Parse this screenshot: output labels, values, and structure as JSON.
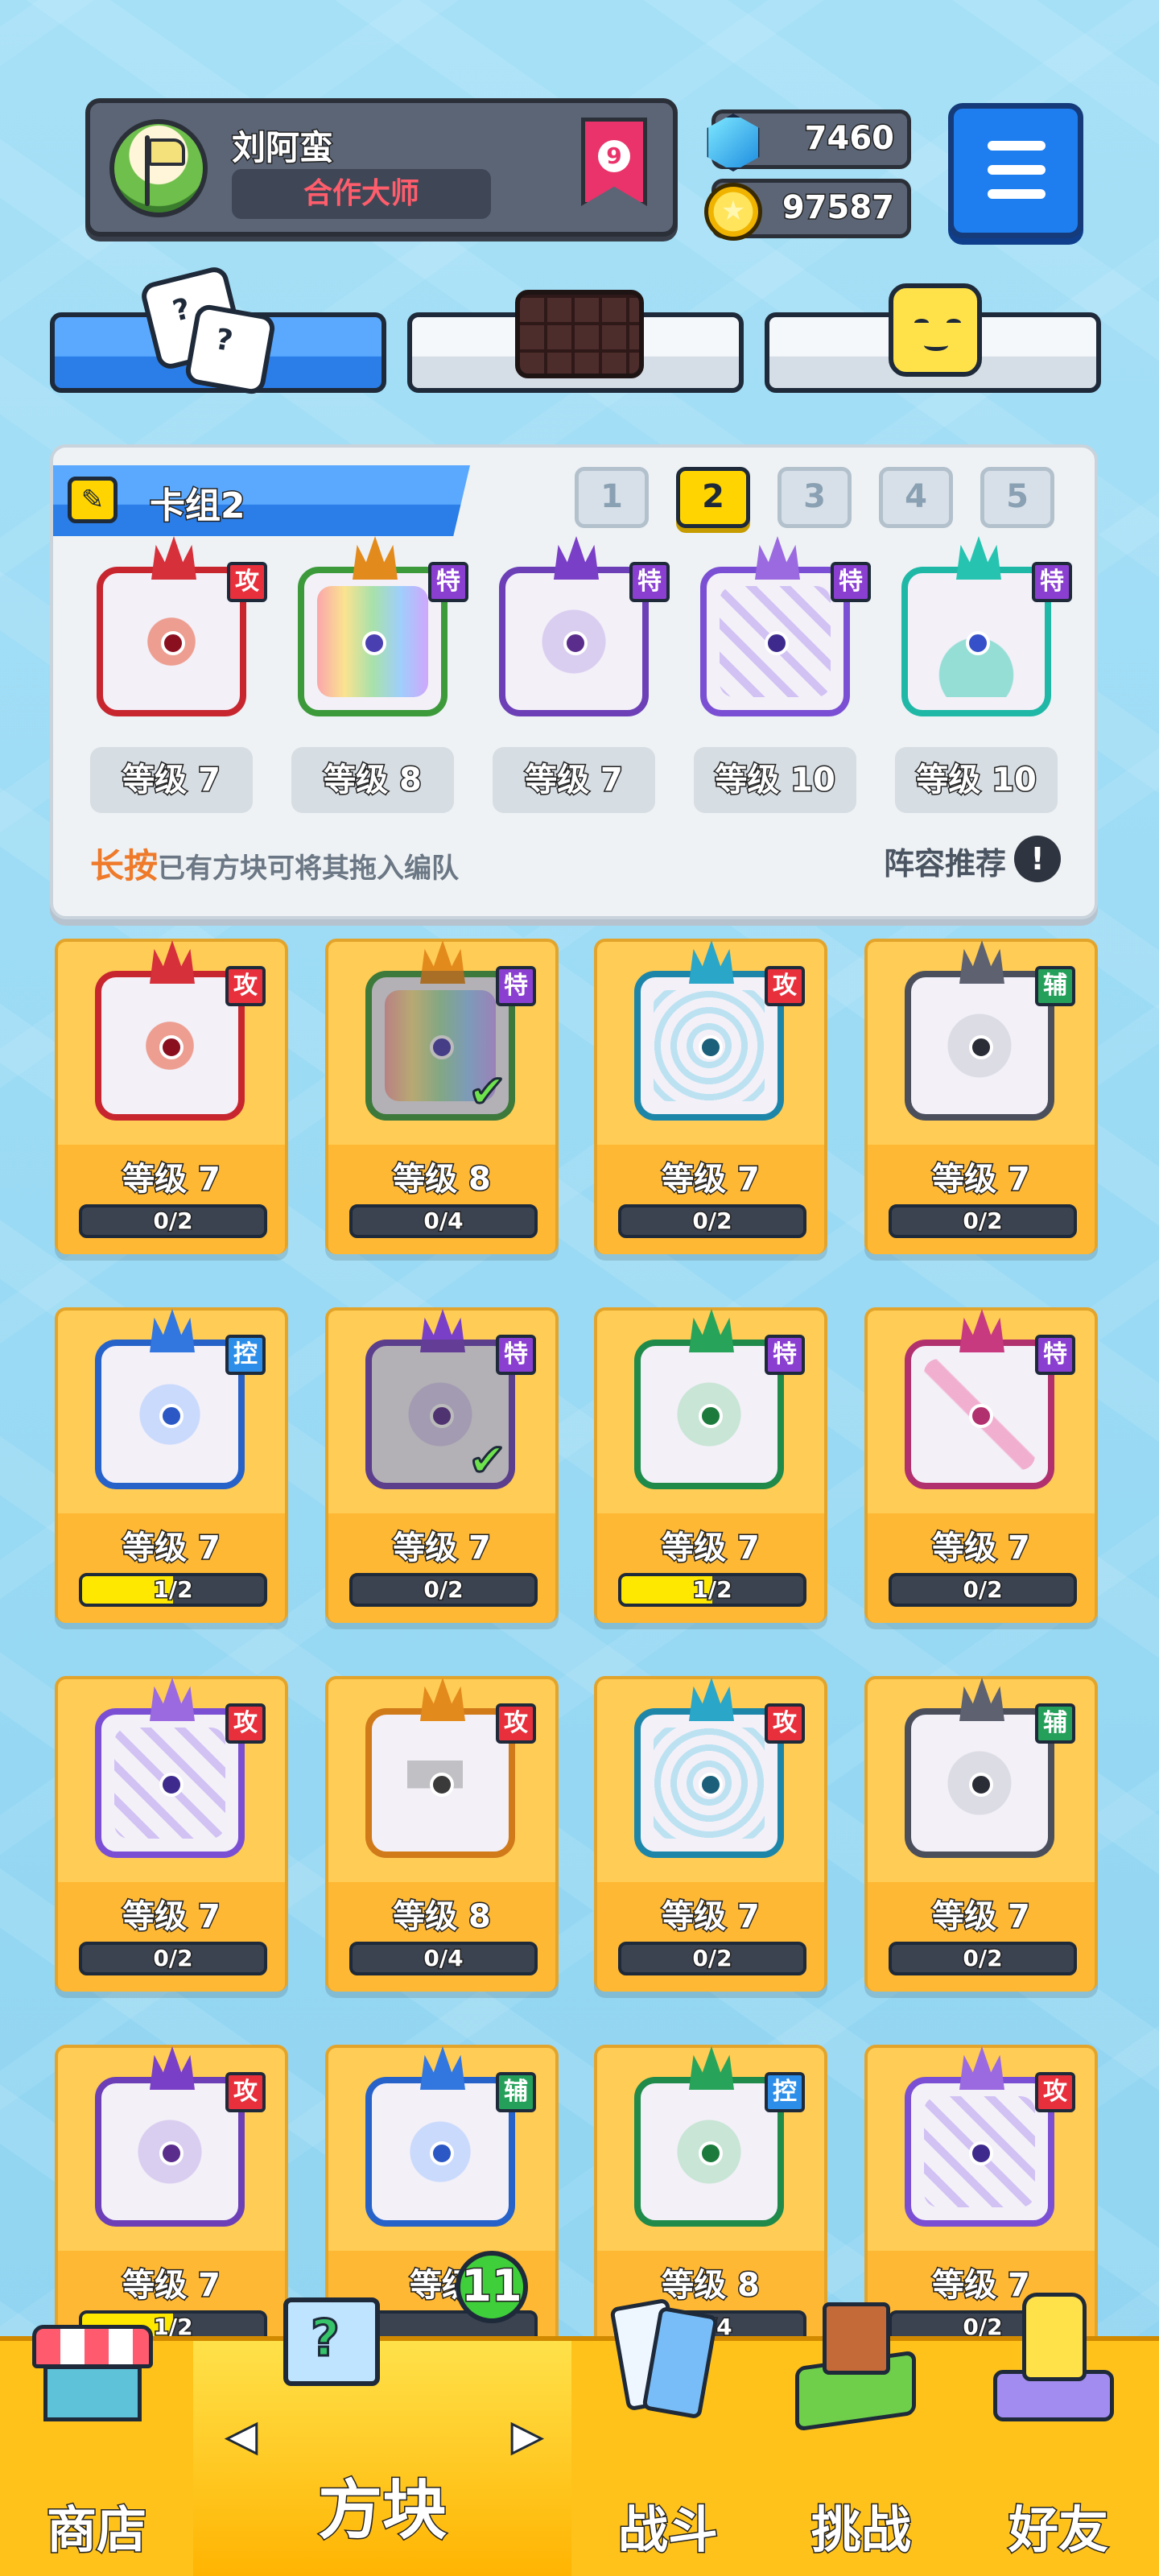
{
  "player": {
    "name": "刘阿蛮",
    "title": "合作大师",
    "rank": "9"
  },
  "currency": {
    "gems": "7460",
    "coins": "97587"
  },
  "top_tabs": [
    {
      "icon": "dice-icon",
      "active": true
    },
    {
      "icon": "chocolate-board-icon",
      "active": false
    },
    {
      "icon": "smiley-cube-icon",
      "active": false
    }
  ],
  "deck": {
    "title": "卡组2",
    "tabs": [
      "1",
      "2",
      "3",
      "4",
      "5"
    ],
    "active_tab": "2",
    "slots": [
      {
        "type": "攻",
        "level": "等级 7",
        "theme": "red",
        "pattern": "sawblade"
      },
      {
        "type": "特",
        "level": "等级 8",
        "theme": "rainbow",
        "pattern": "infinity"
      },
      {
        "type": "特",
        "level": "等级 7",
        "theme": "purple",
        "pattern": "circle-arrows"
      },
      {
        "type": "特",
        "level": "等级 10",
        "theme": "violet",
        "pattern": "cracked"
      },
      {
        "type": "特",
        "level": "等级 10",
        "theme": "teal",
        "pattern": "hands"
      }
    ],
    "hint_highlight": "长按",
    "hint_text": "已有方块可将其拖入编队",
    "recommend_label": "阵容推荐",
    "info_symbol": "!"
  },
  "collection": [
    {
      "type": "攻",
      "level": "等级 7",
      "progress": "0/2",
      "fill": 0,
      "theme": "red",
      "checked": false
    },
    {
      "type": "特",
      "level": "等级 8",
      "progress": "0/4",
      "fill": 0,
      "theme": "rainbow",
      "checked": true
    },
    {
      "type": "攻",
      "level": "等级 7",
      "progress": "0/2",
      "fill": 0,
      "theme": "cyan",
      "checked": false
    },
    {
      "type": "辅",
      "level": "等级 7",
      "progress": "0/2",
      "fill": 0,
      "theme": "gray",
      "checked": false
    },
    {
      "type": "控",
      "level": "等级 7",
      "progress": "1/2",
      "fill": 0.5,
      "theme": "blue",
      "checked": false
    },
    {
      "type": "特",
      "level": "等级 7",
      "progress": "0/2",
      "fill": 0,
      "theme": "purple",
      "checked": true
    },
    {
      "type": "特",
      "level": "等级 7",
      "progress": "1/2",
      "fill": 0.5,
      "theme": "green",
      "checked": false
    },
    {
      "type": "特",
      "level": "等级 7",
      "progress": "0/2",
      "fill": 0,
      "theme": "pink",
      "checked": false
    },
    {
      "type": "攻",
      "level": "等级 7",
      "progress": "0/2",
      "fill": 0,
      "theme": "violet",
      "checked": false
    },
    {
      "type": "攻",
      "level": "等级 8",
      "progress": "0/4",
      "fill": 0,
      "theme": "orange",
      "checked": false
    },
    {
      "type": "攻",
      "level": "等级 7",
      "progress": "0/2",
      "fill": 0,
      "theme": "cyan",
      "checked": false
    },
    {
      "type": "辅",
      "level": "等级 7",
      "progress": "0/2",
      "fill": 0,
      "theme": "gray",
      "checked": false
    },
    {
      "type": "攻",
      "level": "等级 7",
      "progress": "1/2",
      "fill": 0.5,
      "theme": "purple",
      "checked": false
    },
    {
      "type": "辅",
      "level": "等级",
      "progress": "",
      "fill": 0,
      "theme": "blue",
      "checked": false
    },
    {
      "type": "控",
      "level": "等级 8",
      "progress": "0/4",
      "fill": 0,
      "theme": "green",
      "checked": false
    },
    {
      "type": "攻",
      "level": "等级 7",
      "progress": "0/2",
      "fill": 0,
      "theme": "violet",
      "checked": false
    }
  ],
  "bottom_nav": [
    {
      "label": "商店",
      "icon": "shop-icon",
      "active": false
    },
    {
      "label": "方块",
      "icon": "cube-icon",
      "active": true,
      "badge": "11",
      "prev_arrow": "◀",
      "next_arrow": "▶"
    },
    {
      "label": "战斗",
      "icon": "battle-cards-icon",
      "active": false
    },
    {
      "label": "挑战",
      "icon": "challenge-icon",
      "active": false
    },
    {
      "label": "好友",
      "icon": "friends-icon",
      "active": false
    }
  ],
  "colors": {
    "background": "#9fdcf5",
    "accent_blue": "#2b7ee8",
    "card_yellow": "#ffcc55",
    "type_attack": "#e8303d",
    "type_special": "#8a3fd1",
    "type_support": "#25a05a",
    "type_control": "#2c8ee8",
    "progress_fill": "#ffe800"
  }
}
